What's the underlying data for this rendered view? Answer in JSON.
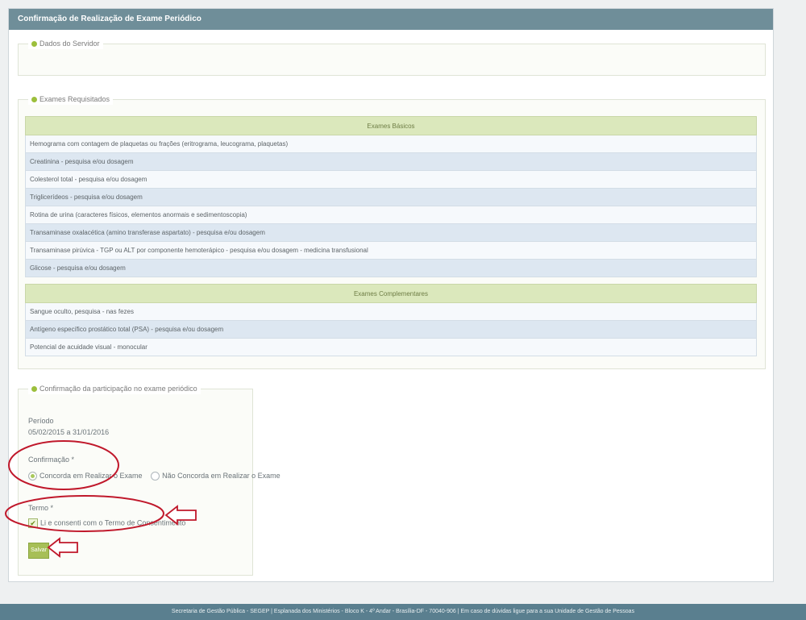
{
  "window": {
    "title": "Confirmação de Realização de Exame Periódico"
  },
  "server_section": {
    "legend": "Dados do Servidor"
  },
  "exams_section": {
    "legend": "Exames Requisitados",
    "basic_header": "Exames Básicos",
    "basic_exams": [
      "Hemograma com contagem de plaquetas ou frações (eritrograma, leucograma, plaquetas)",
      "Creatinina - pesquisa e/ou dosagem",
      "Colesterol total - pesquisa e/ou dosagem",
      "Triglicerídeos - pesquisa e/ou dosagem",
      "Rotina de urina (caracteres físicos, elementos anormais e sedimentoscopia)",
      "Transaminase oxalacética (amino transferase aspartato) - pesquisa e/ou dosagem",
      "Transaminase pirúvica - TGP ou ALT por componente hemoterápico - pesquisa e/ou dosagem - medicina transfusional",
      "Glicose - pesquisa e/ou dosagem"
    ],
    "complementary_header": "Exames Complementares",
    "complementary_exams": [
      "Sangue oculto, pesquisa - nas fezes",
      "Antígeno específico prostático total (PSA) - pesquisa e/ou dosagem",
      "Potencial de acuidade visual - monocular"
    ]
  },
  "confirmation_section": {
    "legend": "Confirmação da participação no exame periódico",
    "period_label": "Período",
    "period_value": "05/02/2015 a 31/01/2016",
    "confirmation_label": "Confirmação *",
    "option_agree": "Concorda em Realizar o Exame",
    "option_disagree": "Não Concorda em Realizar o Exame",
    "selected_option": "Concorda em Realizar o Exame",
    "term_label": "Termo *",
    "term_checkbox_label": "Li e consenti com o Termo de Consentimento",
    "term_checked": true,
    "save_label": "Salvar"
  },
  "footer": {
    "text": "Secretaria de Gestão Pública - SEGEP | Esplanada dos Ministérios - Bloco K - 4º Andar - Brasília-DF - 70040-906 | Em caso de dúvidas ligue para a sua Unidade de Gestão de Pessoas"
  },
  "colors": {
    "title_bar": "#6f8e99",
    "accent_green": "#9cbf3c",
    "annotation_red": "#c0182b",
    "footer": "#5a7f8f"
  }
}
